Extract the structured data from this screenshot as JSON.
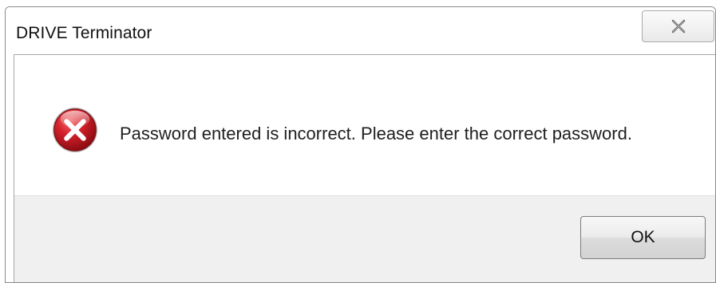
{
  "window": {
    "title": "DRIVE Terminator"
  },
  "dialog": {
    "message": "Password entered is incorrect. Please enter the correct password.",
    "icon": "error-icon",
    "ok_label": "OK"
  },
  "titlebar": {
    "close_icon": "close-icon"
  },
  "colors": {
    "error_red": "#c4161c",
    "button_bar": "#f0f0f0"
  }
}
